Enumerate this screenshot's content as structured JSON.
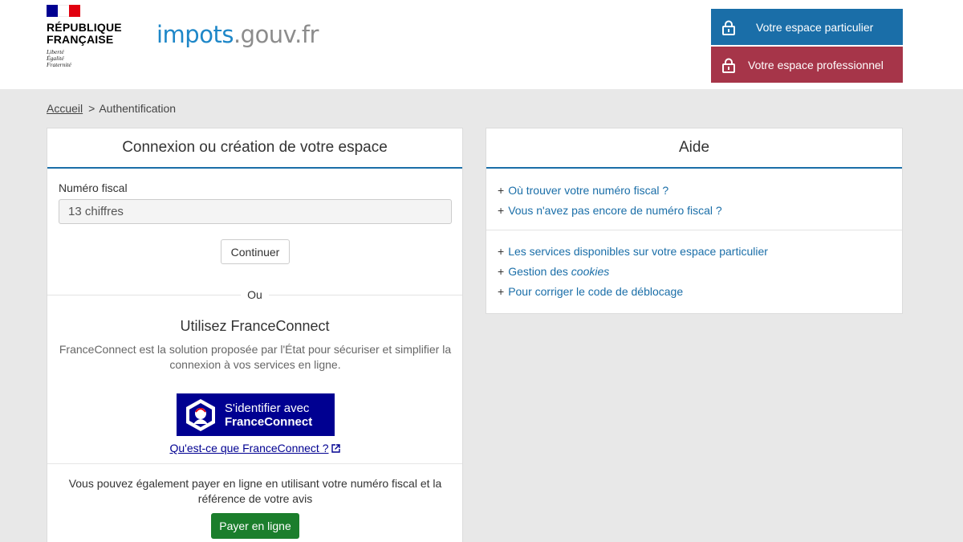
{
  "header": {
    "republic_line1": "RÉPUBLIQUE",
    "republic_line2": "FRANÇAISE",
    "motto": [
      "Liberté",
      "Égalité",
      "Fraternité"
    ],
    "site_name_part1": "impots",
    "site_name_part2": ".gouv.fr",
    "particular_space_label": "Votre espace particulier",
    "professional_space_label": "Votre espace professionnel"
  },
  "breadcrumb": {
    "home": "Accueil",
    "separator": ">",
    "current": "Authentification"
  },
  "login": {
    "title": "Connexion ou création de votre espace",
    "fiscal_label": "Numéro fiscal",
    "fiscal_placeholder": "13 chiffres",
    "fiscal_value": "",
    "continue_label": "Continuer",
    "or_label": "Ou",
    "franceconnect_title": "Utilisez FranceConnect",
    "franceconnect_description": "FranceConnect est la solution proposée par l'État pour sécuriser et simplifier la connexion à vos services en ligne.",
    "franceconnect_button_line1": "S'identifier avec",
    "franceconnect_button_line2": "FranceConnect",
    "franceconnect_link": "Qu'est-ce que FranceConnect ?",
    "pay_description": "Vous pouvez également payer en ligne en utilisant votre numéro fiscal et la référence de votre avis",
    "pay_button_label": "Payer en ligne"
  },
  "help": {
    "title": "Aide",
    "bullet": "+",
    "group1": [
      "Où trouver votre numéro fiscal ?",
      "Vous n'avez pas encore de numéro fiscal ?"
    ],
    "group2": [
      "Les services disponibles sur votre espace particulier",
      {
        "prefix": "Gestion des ",
        "emphasis": "cookies"
      },
      "Pour corriger le code de déblocage"
    ]
  },
  "colors": {
    "brand_blue": "#1a6ea8",
    "professional_red": "#a63549",
    "franceconnect_blue": "#000091",
    "pay_green": "#1b7e2c",
    "page_background": "#e8e8e8"
  },
  "icons": {
    "space_buttons": "lock-icon",
    "franceconnect_link": "external-link-icon"
  }
}
